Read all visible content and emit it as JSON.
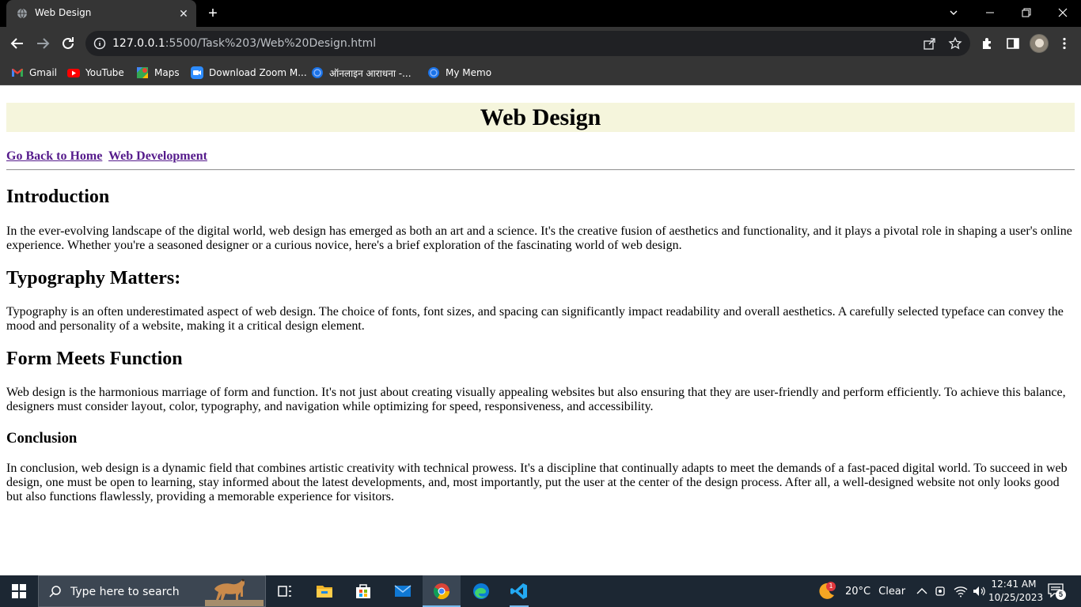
{
  "browser": {
    "tab": {
      "title": "Web Design",
      "close_glyph": "✕"
    },
    "new_tab_glyph": "+",
    "window_controls": {
      "minimize": "—",
      "restore": "❐",
      "close": "✕",
      "tab_search": "⌄"
    },
    "address": {
      "host": "127.0.0.1",
      "path": ":5500/Task%203/Web%20Design.html"
    },
    "icons": [
      "back-icon",
      "forward-icon",
      "reload-icon",
      "info-icon",
      "share-icon",
      "star-icon",
      "extensions-icon",
      "side-panel-icon",
      "profile-avatar",
      "menu-icon"
    ],
    "bookmarks": [
      {
        "label": "Gmail",
        "icon": "gmail-icon"
      },
      {
        "label": "YouTube",
        "icon": "youtube-icon"
      },
      {
        "label": "Maps",
        "icon": "maps-icon"
      },
      {
        "label": "Download Zoom M...",
        "icon": "zoom-icon"
      },
      {
        "label": "ऑनलाइन आराधना -...",
        "icon": "globe-icon"
      },
      {
        "label": "My Memo",
        "icon": "globe-icon"
      }
    ]
  },
  "page": {
    "title": "Web Design",
    "nav_links": [
      "Go Back to Home",
      "Web Development"
    ],
    "sections": [
      {
        "heading": "Introduction",
        "text": "In the ever-evolving landscape of the digital world, web design has emerged as both an art and a science. It's the creative fusion of aesthetics and functionality, and it plays a pivotal role in shaping a user's online experience. Whether you're a seasoned designer or a curious novice, here's a brief exploration of the fascinating world of web design."
      },
      {
        "heading": "Typography Matters:",
        "text": "Typography is an often underestimated aspect of web design. The choice of fonts, font sizes, and spacing can significantly impact readability and overall aesthetics. A carefully selected typeface can convey the mood and personality of a website, making it a critical design element."
      },
      {
        "heading": "Form Meets Function",
        "text": "Web design is the harmonious marriage of form and function. It's not just about creating visually appealing websites but also ensuring that they are user-friendly and perform efficiently. To achieve this balance, designers must consider layout, color, typography, and navigation while optimizing for speed, responsiveness, and accessibility."
      },
      {
        "heading": "Conclusion",
        "text": "In conclusion, web design is a dynamic field that combines artistic creativity with technical prowess. It's a discipline that continually adapts to meet the demands of a fast-paced digital world. To succeed in web design, one must be open to learning, stay informed about the latest developments, and, most importantly, put the user at the center of the design process. After all, a well-designed website not only looks good but also functions flawlessly, providing a memorable experience for visitors."
      }
    ],
    "colors": {
      "header_bg": "#f5f5dc",
      "visited_link": "#551a8b"
    }
  },
  "taskbar": {
    "search_placeholder": "Type here to search",
    "apps": [
      "task-view-icon",
      "file-explorer-icon",
      "microsoft-store-icon",
      "mail-icon",
      "chrome-icon",
      "edge-icon",
      "vscode-icon"
    ],
    "weather": {
      "temp": "20°C",
      "condition": "Clear",
      "badge": "1"
    },
    "clock": {
      "time": "12:41 AM",
      "date": "10/25/2023"
    },
    "notifications_count": "5"
  }
}
